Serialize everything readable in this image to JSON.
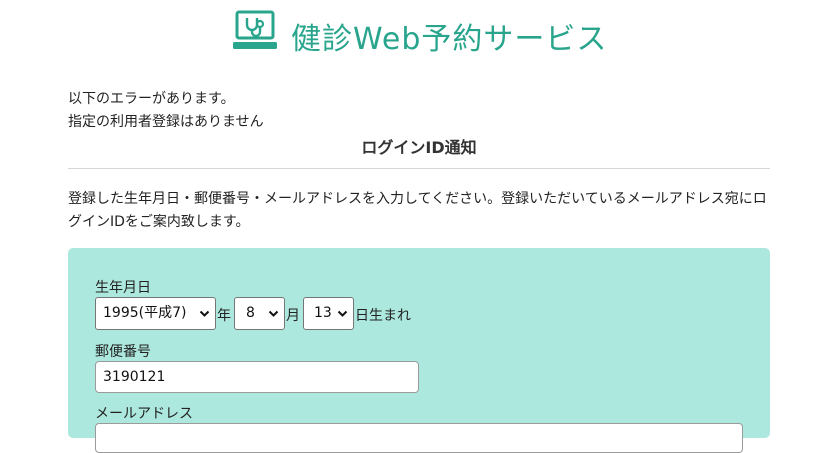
{
  "brand": {
    "title": "健診Web予約サービス",
    "color": "#2aa58d",
    "icon": "laptop-stethoscope-icon"
  },
  "errors": {
    "heading": "以下のエラーがあります。",
    "message": "指定の利用者登録はありません"
  },
  "page": {
    "title": "ログインID通知",
    "intro": "登録した生年月日・郵便番号・メールアドレスを入力してください。登録いただいているメールアドレス宛にログインIDをご案内致します。"
  },
  "form": {
    "panel_color": "#ade8df",
    "birthdate_label": "生年月日",
    "year_value": "1995(平成7)",
    "year_unit": "年",
    "month_value": "8",
    "month_unit": "月",
    "day_value": "13",
    "day_unit": "日生まれ",
    "postal_label": "郵便番号",
    "postal_value": "3190121",
    "email_label": "メールアドレス"
  }
}
